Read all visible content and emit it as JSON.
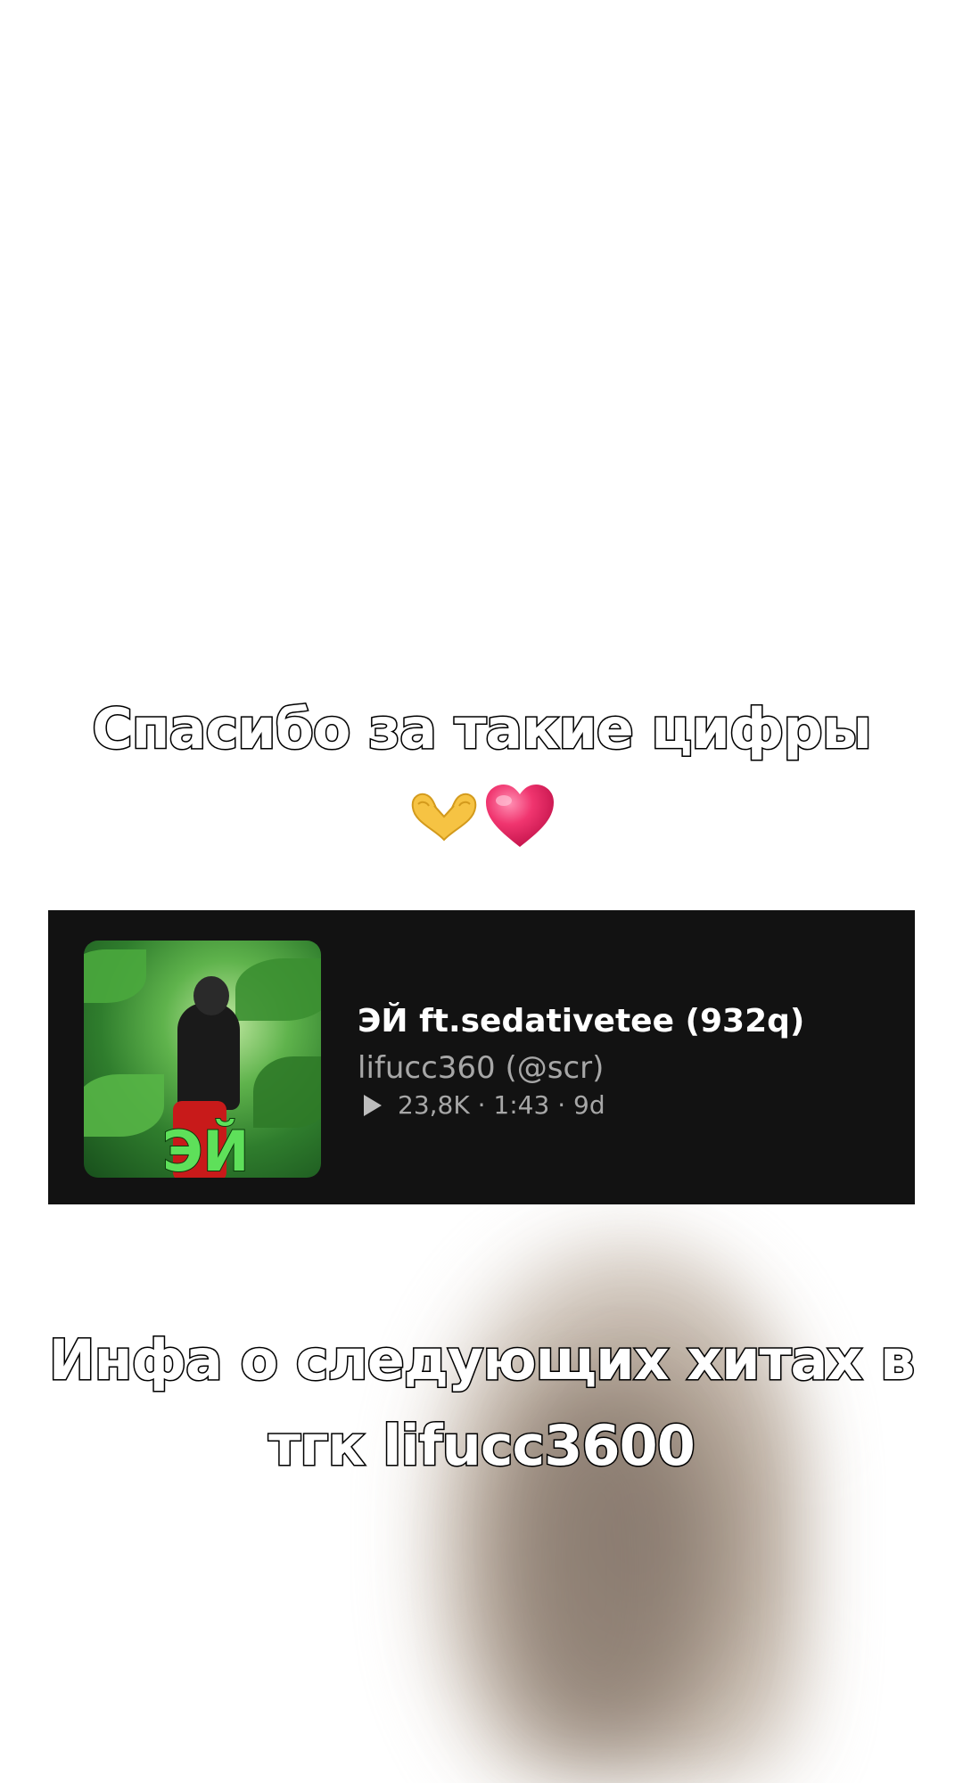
{
  "captions": {
    "top": "Спасибо за такие цифры",
    "bottom_line1": "Инфа о следующих хитах в",
    "bottom_line2": "тгк lifucc3600"
  },
  "emojis": [
    "heart-hands-icon",
    "pink-heart-icon"
  ],
  "track": {
    "cover_text": "ЭЙ",
    "title": "ЭЙ ft.sedativetee (932q)",
    "artist": "lifucc360 (@scr)",
    "plays": "23,8K",
    "duration": "1:43",
    "age": "9d",
    "separator": " · "
  },
  "colors": {
    "card_bg": "#121212",
    "title": "#ffffff",
    "meta": "#a7a7a7",
    "heart": "#f0356f",
    "cover_text": "#5ee05a"
  }
}
